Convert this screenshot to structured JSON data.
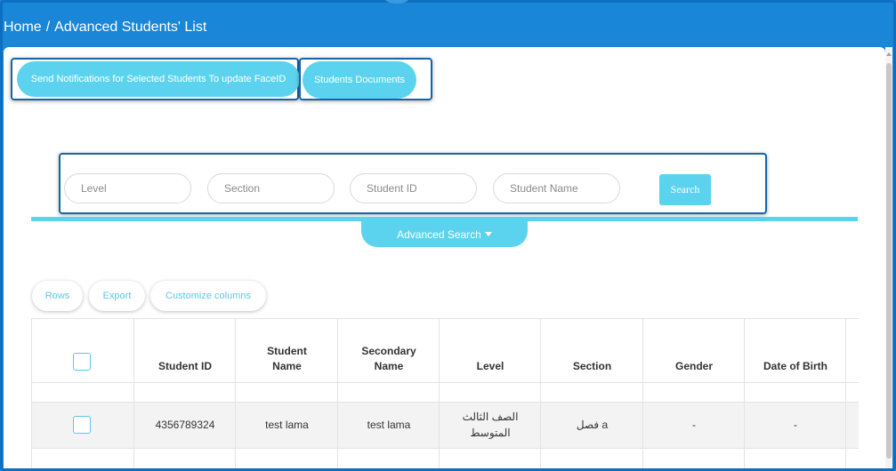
{
  "breadcrumb": {
    "home": "Home",
    "separator": "/",
    "current": "Advanced Students' List"
  },
  "actions": {
    "send_notifications": "Send Notifications for Selected Students To update FaceID",
    "students_documents": "Students Documents"
  },
  "search": {
    "level_placeholder": "Level",
    "section_placeholder": "Section",
    "student_id_placeholder": "Student ID",
    "student_name_placeholder": "Student Name",
    "button": "Search",
    "advanced_label": "Advanced Search"
  },
  "toolbar": {
    "rows": "Rows",
    "export": "Export",
    "customize": "Customize columns"
  },
  "table": {
    "headers": {
      "student_id": "Student ID",
      "student_name_1": "Student",
      "student_name_2": "Name",
      "secondary_name_1": "Secondary",
      "secondary_name_2": "Name",
      "level": "Level",
      "section": "Section",
      "gender": "Gender",
      "dob": "Date of Birth"
    },
    "rows": [
      {
        "student_id": "4356789324",
        "student_name": "test lama",
        "secondary_name": "test lama",
        "level_1": "الصف الثالث",
        "level_2": "المتوسط",
        "section": "فصل a",
        "gender": "-",
        "dob": "-"
      }
    ]
  },
  "colors": {
    "brand": "#1a86d8",
    "accent": "#5cd3ee",
    "highlight": "#1565a8"
  }
}
